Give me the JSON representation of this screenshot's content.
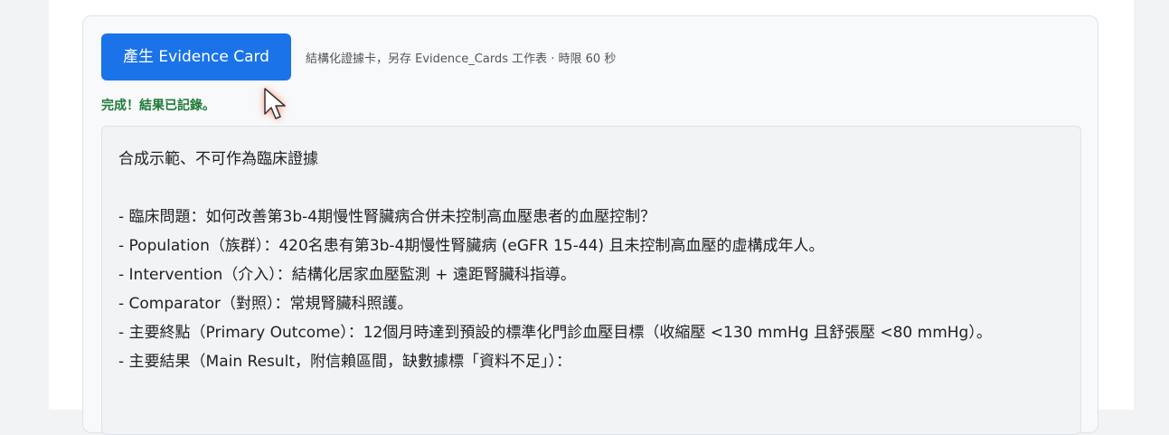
{
  "button": {
    "label": "產生 Evidence Card"
  },
  "hint": "結構化證據卡，另存 Evidence_Cards 工作表 · 時限 60 秒",
  "status": "完成！結果已記錄。",
  "result": {
    "disclaimer": "合成示範、不可作為臨床證據",
    "lines": [
      "- 臨床問題：如何改善第3b-4期慢性腎臟病合併未控制高血壓患者的血壓控制？",
      "- Population（族群）：420名患有第3b-4期慢性腎臟病 (eGFR 15-44) 且未控制高血壓的虛構成年人。",
      "- Intervention（介入）：結構化居家血壓監測 + 遠距腎臟科指導。",
      "- Comparator（對照）：常規腎臟科照護。",
      "- 主要終點（Primary Outcome）：12個月時達到預設的標準化門診血壓目標（收縮壓 <130 mmHg 且舒張壓 <80 mmHg）。",
      "- 主要結果（Main Result，附信賴區間，缺數據標「資料不足」）："
    ]
  },
  "colors": {
    "button_bg": "#1a73e8",
    "status_green": "#1e7a36",
    "cursor_glow": "#ff6e3c"
  },
  "icons": {
    "cursor": "mouse-pointer-icon"
  }
}
